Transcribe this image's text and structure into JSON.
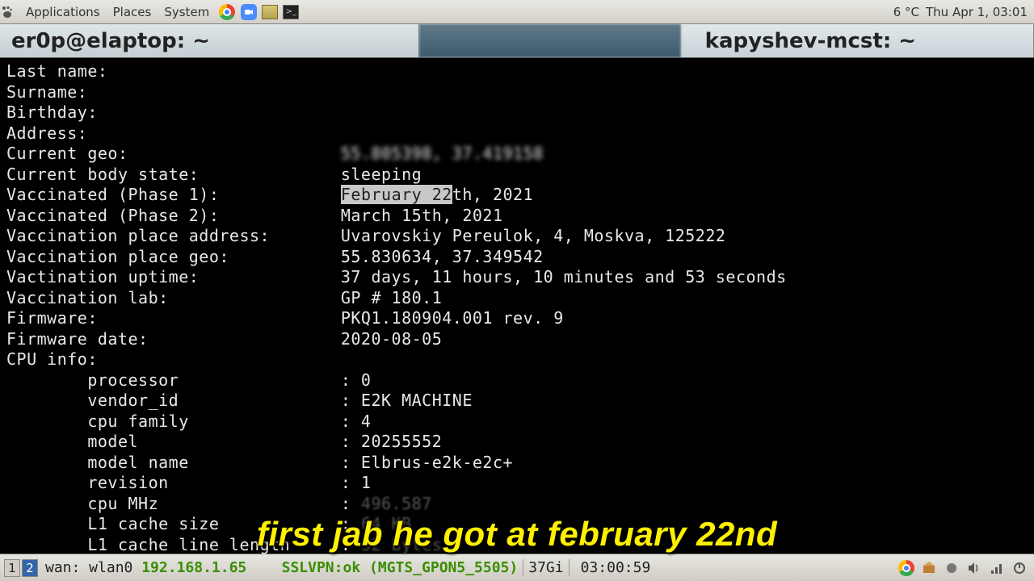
{
  "top_panel": {
    "menu_applications": "Applications",
    "menu_places": "Places",
    "menu_system": "System",
    "weather": "6 °C",
    "clock": "Thu Apr  1, 03:01"
  },
  "titlebar": {
    "left_tab": "er0p@elaptop: ~",
    "right_tab": "kapyshev-mcst: ~"
  },
  "terminal": {
    "lines": [
      {
        "label": "Last name:",
        "value": ""
      },
      {
        "label": "Surname:",
        "value": ""
      },
      {
        "label": "Birthday:",
        "value": ""
      },
      {
        "label": "Address:",
        "value": ""
      },
      {
        "label": "Current geo:",
        "value": "55.805398, 37.419158",
        "blur": true
      },
      {
        "label": "Current body state:",
        "value": "sleeping"
      },
      {
        "label": "Vaccinated (Phase 1):",
        "value_hl": "February 22",
        "value_rest": "th, 2021"
      },
      {
        "label": "Vaccinated (Phase 2):",
        "value": "March 15th, 2021"
      },
      {
        "label": "Vaccination place address:",
        "value": "Uvarovskiy Pereulok, 4, Moskva, 125222"
      },
      {
        "label": "Vaccination place geo:",
        "value": "55.830634, 37.349542"
      },
      {
        "label": "Vactination uptime:",
        "value": "37 days, 11 hours, 10 minutes and 53 seconds"
      },
      {
        "label": "Vaccination lab:",
        "value": "GP # 180.1"
      },
      {
        "label": "Firmware:",
        "value": "PKQ1.180904.001 rev. 9"
      },
      {
        "label": "Firmware date:",
        "value": "2020-08-05"
      },
      {
        "label": "CPU info:",
        "value": ""
      }
    ],
    "cpu": [
      {
        "k": "processor",
        "v": "0"
      },
      {
        "k": "vendor_id",
        "v": "E2K MACHINE"
      },
      {
        "k": "cpu family",
        "v": "4"
      },
      {
        "k": "model",
        "v": "20255552"
      },
      {
        "k": "model name",
        "v": "Elbrus-e2k-e2c+"
      },
      {
        "k": "revision",
        "v": "1"
      },
      {
        "k": "cpu MHz",
        "v": "496.587",
        "dim": true
      },
      {
        "k": "L1 cache size",
        "v": "64 KB",
        "dim": true
      },
      {
        "k": "L1 cache line length",
        "v": "32 bytes",
        "dim": true
      }
    ]
  },
  "subtitle": "first jab he got at february 22nd",
  "bottom_panel": {
    "ws1": "1",
    "ws2": "2",
    "net_label": "wan: wlan0 ",
    "net_ip": "192.168.1.65",
    "vpn": "SSLVPN:ok",
    "ssid": "(MGTS_GPON5_5505)",
    "mem": "37Gi",
    "time": "03:00:59"
  }
}
